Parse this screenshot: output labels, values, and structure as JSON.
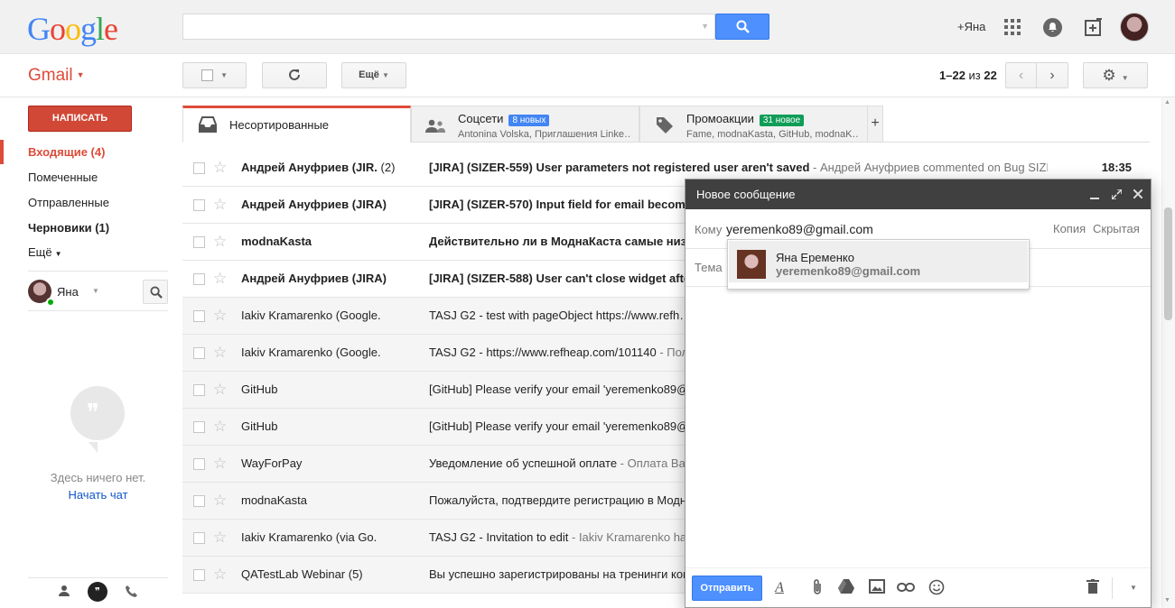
{
  "app": {
    "logo_letters": [
      "G",
      "o",
      "o",
      "g",
      "l",
      "e"
    ],
    "product": "Gmail",
    "user_link": "+Яна"
  },
  "toolbar": {
    "more_label": "Ещё",
    "pager_range": "1–22",
    "pager_of": "из",
    "pager_total": "22"
  },
  "nav": {
    "compose_label": "НАПИСАТЬ",
    "items": [
      {
        "label": "Входящие (4)",
        "active": true
      },
      {
        "label": "Помеченные"
      },
      {
        "label": "Отправленные"
      },
      {
        "label": "Черновики (1)"
      },
      {
        "label": "Ещё"
      }
    ],
    "hangouts_user": "Яна",
    "empty_text": "Здесь ничего нет.",
    "start_chat": "Начать чат"
  },
  "tabs": [
    {
      "label": "Несортированные"
    },
    {
      "label": "Соцсети",
      "badge": "8 новых",
      "badge_color": "#4285f4",
      "sub": "Antonina Volska, Приглашения Linke…"
    },
    {
      "label": "Промоакции",
      "badge": "31 новое",
      "badge_color": "#0f9d58",
      "sub": "Fame, modnaKasta, GitHub, modnaK…"
    }
  ],
  "messages": [
    {
      "from": "Андрей Ануфриев (JIR.",
      "count": "(2)",
      "subject": "[JIRA] (SIZER-559) User parameters not registered user aren't saved",
      "snippet": " - Андрей Ануфриев commented on Bug SIZE",
      "date": "18:35",
      "unread": true
    },
    {
      "from": "Андрей Ануфриев (JIRA)",
      "count": "",
      "subject": "[JIRA] (SIZER-570) Input field for email becom",
      "snippet": "",
      "date": "",
      "unread": true
    },
    {
      "from": "modnaKasta",
      "count": "",
      "subject": "Действительно ли в МоднаКаста самые низ",
      "snippet": "",
      "date": "",
      "unread": true
    },
    {
      "from": "Андрей Ануфриев (JIRA)",
      "count": "",
      "subject": "[JIRA] (SIZER-588) User can't close widget afte",
      "snippet": "",
      "date": "",
      "unread": true
    },
    {
      "from": "Iakiv Kramarenko (Google.",
      "count": "",
      "subject": "TASJ G2 - test with pageObject https://www.refh…",
      "snippet": "",
      "date": "",
      "unread": false
    },
    {
      "from": "Iakiv Kramarenko (Google.",
      "count": "",
      "subject": "TASJ G2 - https://www.refheap.com/101140",
      "snippet": " - Пол",
      "date": "",
      "unread": false
    },
    {
      "from": "GitHub",
      "count": "",
      "subject": "[GitHub] Please verify your email 'yeremenko89@",
      "snippet": "",
      "date": "",
      "unread": false
    },
    {
      "from": "GitHub",
      "count": "",
      "subject": "[GitHub] Please verify your email 'yeremenko89@",
      "snippet": "",
      "date": "",
      "unread": false
    },
    {
      "from": "WayForPay",
      "count": "",
      "subject": "Уведомление об успешной оплате",
      "snippet": " - Оплата Ваш",
      "date": "",
      "unread": false
    },
    {
      "from": "modnaKasta",
      "count": "",
      "subject": "Пожалуйста, подтвердите регистрацию в Модн",
      "snippet": "",
      "date": "",
      "unread": false
    },
    {
      "from": "Iakiv Kramarenko (via Go.",
      "count": "",
      "subject": "TASJ G2 - Invitation to edit",
      "snippet": " - Iakiv Kramarenko ha",
      "date": "",
      "unread": false
    },
    {
      "from": "QATestLab Webinar (5)",
      "count": "",
      "subject": "Вы успешно зарегистрированы на тренинги комп",
      "snippet": "",
      "date": "",
      "unread": false
    }
  ],
  "compose": {
    "title": "Новое сообщение",
    "to_label": "Кому",
    "to_value": "yeremenko89@gmail.com",
    "cc": "Копия",
    "bcc": "Скрытая",
    "subject_label": "Тема",
    "suggestion_name": "Яна Еременко",
    "suggestion_email": "yeremenko89@gmail.com",
    "send_label": "Отправить"
  },
  "colors": {
    "accent_red": "#dd4b39",
    "blue": "#4d90fe"
  }
}
